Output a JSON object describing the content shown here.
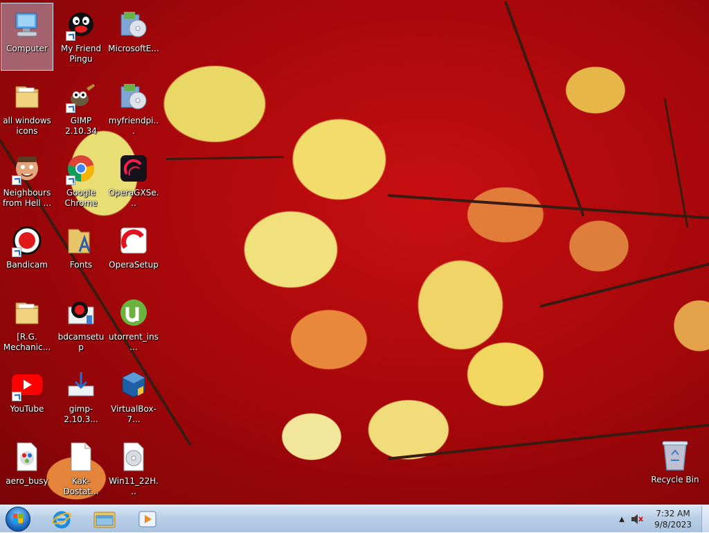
{
  "desktop_icons": [
    {
      "label": "Computer",
      "icon": "computer-icon",
      "shortcut": false,
      "selected": true
    },
    {
      "label": "My Friend Pingu",
      "icon": "pingu-icon",
      "shortcut": true
    },
    {
      "label": "MicrosoftE...",
      "icon": "installer-icon",
      "shortcut": false
    },
    {
      "label": "all windows icons",
      "icon": "folder-icon",
      "shortcut": false
    },
    {
      "label": "GIMP 2.10.34",
      "icon": "gimp-icon",
      "shortcut": true
    },
    {
      "label": "myfriendpi...",
      "icon": "installer-icon",
      "shortcut": false
    },
    {
      "label": "Neighbours from Hell ...",
      "icon": "neighbour-icon",
      "shortcut": true
    },
    {
      "label": "Google Chrome",
      "icon": "chrome-icon",
      "shortcut": true
    },
    {
      "label": "OperaGXSe...",
      "icon": "operagx-icon",
      "shortcut": false
    },
    {
      "label": "Bandicam",
      "icon": "bandicam-icon",
      "shortcut": true
    },
    {
      "label": "Fonts",
      "icon": "fonts-folder-icon",
      "shortcut": false
    },
    {
      "label": "OperaSetup",
      "icon": "opera-icon",
      "shortcut": false
    },
    {
      "label": "[R.G. Mechanic...",
      "icon": "folder-icon",
      "shortcut": false
    },
    {
      "label": "bdcamsetup",
      "icon": "bandicam-setup-icon",
      "shortcut": false
    },
    {
      "label": "utorrent_ins...",
      "icon": "utorrent-icon",
      "shortcut": false
    },
    {
      "label": "YouTube",
      "icon": "youtube-icon",
      "shortcut": true
    },
    {
      "label": "gimp-2.10.3...",
      "icon": "download-installer-icon",
      "shortcut": false
    },
    {
      "label": "VirtualBox-7...",
      "icon": "virtualbox-icon",
      "shortcut": false
    },
    {
      "label": "aero_busy",
      "icon": "cursor-file-icon",
      "shortcut": false
    },
    {
      "label": "Kak-Dostat...",
      "icon": "blank-file-icon",
      "shortcut": false
    },
    {
      "label": "Win11_22H...",
      "icon": "disc-image-icon",
      "shortcut": false
    }
  ],
  "recycle_bin": {
    "label": "Recycle Bin",
    "icon": "recycle-bin-icon"
  },
  "taskbar": {
    "pinned": [
      {
        "name": "internet-explorer",
        "icon": "internet-explorer-icon"
      },
      {
        "name": "windows-explorer",
        "icon": "file-explorer-icon"
      },
      {
        "name": "media-player",
        "icon": "media-player-icon"
      }
    ],
    "clock": {
      "time": "7:32 AM",
      "date": "9/8/2023"
    },
    "tray": [
      "show-hidden-icons-icon",
      "volume-muted-icon"
    ]
  }
}
